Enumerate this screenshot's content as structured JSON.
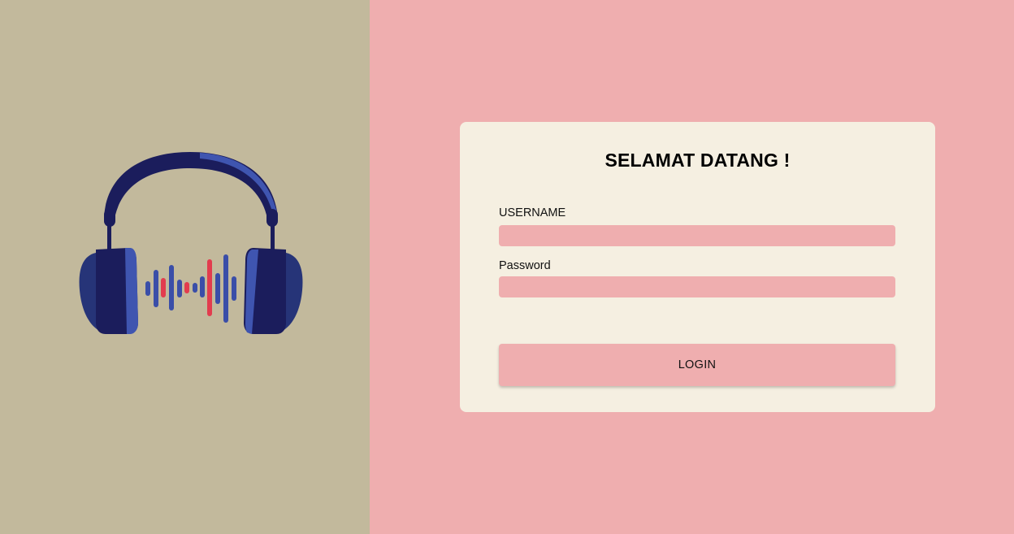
{
  "colors": {
    "left_bg": "#c2b99c",
    "right_bg": "#efaeaf",
    "card_bg": "#f5efe1",
    "input_bg": "#efaeaf",
    "headphone_dark": "#1b1d5c",
    "headphone_mid": "#2c3a8a",
    "headphone_light": "#3f55b0",
    "wave_blue": "#3a4ea8",
    "wave_red": "#e23c4e"
  },
  "logo": {
    "icon": "headphones-soundwave-icon"
  },
  "login": {
    "title": "SELAMAT DATANG !",
    "username_label": "USERNAME",
    "username_value": "",
    "password_label": "Password",
    "password_value": "",
    "button_label": "LOGIN"
  }
}
